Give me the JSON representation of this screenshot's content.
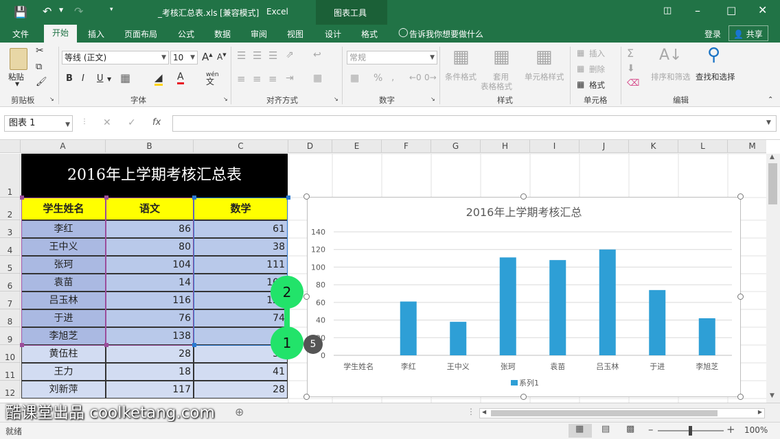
{
  "titlebar": {
    "filename": "_考核汇总表.xls",
    "mode": "[兼容模式]",
    "app": "Excel",
    "context_tools": "图表工具"
  },
  "tabs": [
    "文件",
    "开始",
    "插入",
    "页面布局",
    "公式",
    "数据",
    "审阅",
    "视图",
    "设计",
    "格式"
  ],
  "tellme": "告诉我你想要做什么",
  "login": "登录",
  "share": "共享",
  "ribbon": {
    "paste": "粘贴",
    "clipboard": "剪贴板",
    "font_name": "等线 (正文)",
    "font_size": "10",
    "font_group": "字体",
    "bold": "B",
    "italic": "I",
    "underline": "U",
    "wen": "wén",
    "wen2": "文",
    "align_group": "对齐方式",
    "num_format": "常规",
    "num_group": "数字",
    "percent": "%",
    "cond_format": "条件格式",
    "table_format_1": "套用",
    "table_format_2": "表格格式",
    "cell_style": "单元格样式",
    "style_group": "样式",
    "insert": "插入",
    "delete": "删除",
    "format": "格式",
    "cells_group": "单元格",
    "sort_filter": "排序和筛选",
    "find_select": "查找和选择",
    "edit_group": "编辑"
  },
  "formula": {
    "namebox": "图表 1",
    "fx": "fx"
  },
  "columns": [
    "A",
    "B",
    "C",
    "D",
    "E",
    "F",
    "G",
    "H",
    "I",
    "J",
    "K",
    "L",
    "M"
  ],
  "rows": [
    "1",
    "2",
    "3",
    "4",
    "5",
    "6",
    "7",
    "8",
    "9",
    "10",
    "11",
    "12"
  ],
  "table": {
    "title": "2016年上学期考核汇总表",
    "headers": [
      "学生姓名",
      "语文",
      "数学"
    ],
    "data": [
      [
        "李红",
        "86",
        "61"
      ],
      [
        "王中义",
        "80",
        "38"
      ],
      [
        "张珂",
        "104",
        "111"
      ],
      [
        "袁苗",
        "14",
        "108"
      ],
      [
        "吕玉林",
        "116",
        "120"
      ],
      [
        "于进",
        "76",
        "74"
      ],
      [
        "李旭芝",
        "138",
        "42"
      ],
      [
        "黄伍柱",
        "28",
        "52"
      ],
      [
        "王力",
        "18",
        "41"
      ],
      [
        "刘新萍",
        "117",
        "28"
      ]
    ]
  },
  "chart_data": {
    "type": "bar",
    "title": "2016年上学期考核汇总",
    "categories": [
      "学生姓名",
      "李红",
      "王中义",
      "张珂",
      "袁苗",
      "吕玉林",
      "于进",
      "李旭芝"
    ],
    "series": [
      {
        "name": "系列1",
        "values": [
          0,
          61,
          38,
          111,
          108,
          120,
          74,
          42
        ]
      }
    ],
    "ylim": [
      0,
      140
    ],
    "yticks": [
      "0",
      "20",
      "40",
      "60",
      "80",
      "100",
      "120",
      "140"
    ],
    "legend": "bottom",
    "color": "#2e9fd6"
  },
  "annotations": {
    "step_a": "2",
    "step_b": "1",
    "step_c": "5"
  },
  "watermark": "酷课堂出品 coolketang.com",
  "status": {
    "ready": "就绪",
    "zoom": "100%"
  },
  "colors": {
    "brand": "#217346",
    "title_bg": "#000000",
    "header_bg": "#ffff00",
    "bar": "#2e9fd6",
    "green_circle": "#22e36a"
  }
}
